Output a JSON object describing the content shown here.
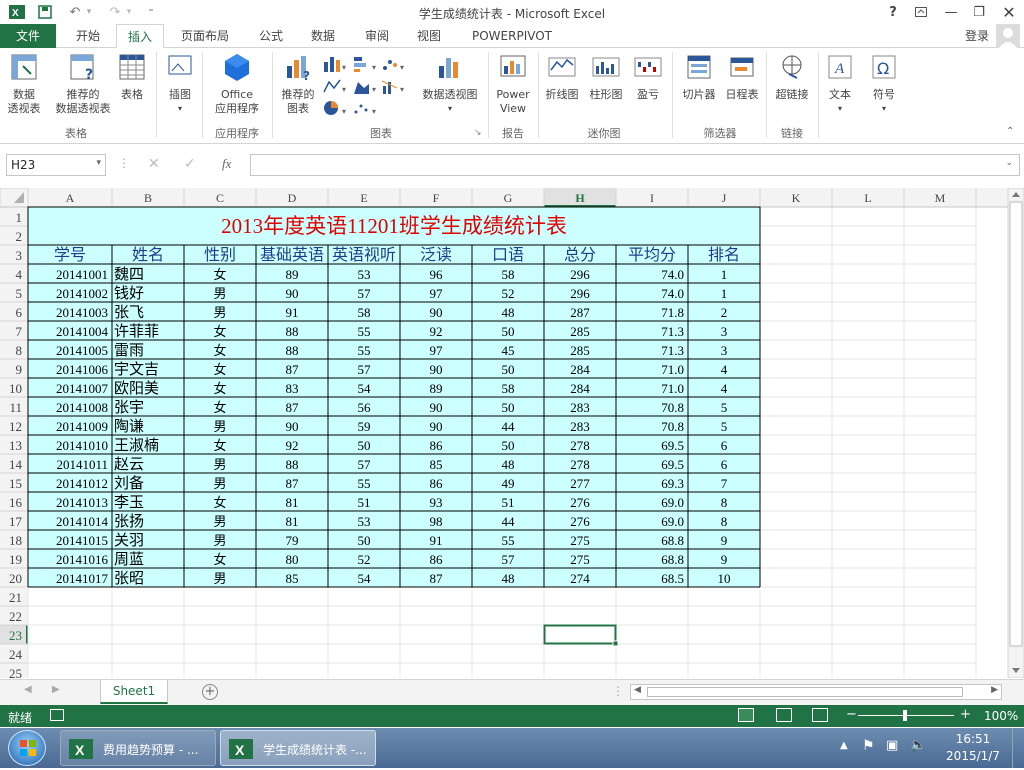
{
  "window": {
    "title": "学生成绩统计表 - Microsoft Excel",
    "help": "?",
    "login": "登录"
  },
  "tabs": [
    {
      "label": "文件",
      "id": "file"
    },
    {
      "label": "开始",
      "id": "home"
    },
    {
      "label": "插入",
      "id": "insert"
    },
    {
      "label": "页面布局",
      "id": "layout"
    },
    {
      "label": "公式",
      "id": "formulas"
    },
    {
      "label": "数据",
      "id": "data"
    },
    {
      "label": "审阅",
      "id": "review"
    },
    {
      "label": "视图",
      "id": "view"
    },
    {
      "label": "POWERPIVOT",
      "id": "powerpivot"
    }
  ],
  "ribbon": {
    "pivot_table": "数据\n透视表",
    "recommended_pivot": "推荐的\n数据透视表",
    "table": "表格",
    "illustrations": "插图",
    "office_apps": "Office\n应用程序",
    "recommended_charts": "推荐的\n图表",
    "pivot_chart": "数据透视图",
    "power_view": "Power\nView",
    "line_spark": "折线图",
    "column_spark": "柱形图",
    "winloss_spark": "盈亏",
    "slicer": "切片器",
    "timeline": "日程表",
    "hyperlink": "超链接",
    "text": "文本",
    "symbol": "符号",
    "groups": {
      "tables": "表格",
      "apps": "应用程序",
      "charts": "图表",
      "reports": "报告",
      "sparklines": "迷你图",
      "filters": "筛选器",
      "links": "链接"
    }
  },
  "namebox": "H23",
  "fx": "fx",
  "columns": [
    "A",
    "B",
    "C",
    "D",
    "E",
    "F",
    "G",
    "H",
    "I",
    "J",
    "K",
    "L",
    "M"
  ],
  "sheet_title": "2013年度英语11201班学生成绩统计表",
  "headers": [
    "学号",
    "姓名",
    "性别",
    "基础英语",
    "英语视听",
    "泛读",
    "口语",
    "总分",
    "平均分",
    "排名"
  ],
  "rows": [
    [
      "20141001",
      "魏四",
      "女",
      "89",
      "53",
      "96",
      "58",
      "296",
      "74.0",
      "1"
    ],
    [
      "20141002",
      "钱好",
      "男",
      "90",
      "57",
      "97",
      "52",
      "296",
      "74.0",
      "1"
    ],
    [
      "20141003",
      "张飞",
      "男",
      "91",
      "58",
      "90",
      "48",
      "287",
      "71.8",
      "2"
    ],
    [
      "20141004",
      "许菲菲",
      "女",
      "88",
      "55",
      "92",
      "50",
      "285",
      "71.3",
      "3"
    ],
    [
      "20141005",
      "雷雨",
      "女",
      "88",
      "55",
      "97",
      "45",
      "285",
      "71.3",
      "3"
    ],
    [
      "20141006",
      "宇文吉",
      "女",
      "87",
      "57",
      "90",
      "50",
      "284",
      "71.0",
      "4"
    ],
    [
      "20141007",
      "欧阳美",
      "女",
      "83",
      "54",
      "89",
      "58",
      "284",
      "71.0",
      "4"
    ],
    [
      "20141008",
      "张宇",
      "女",
      "87",
      "56",
      "90",
      "50",
      "283",
      "70.8",
      "5"
    ],
    [
      "20141009",
      "陶谦",
      "男",
      "90",
      "59",
      "90",
      "44",
      "283",
      "70.8",
      "5"
    ],
    [
      "20141010",
      "王淑楠",
      "女",
      "92",
      "50",
      "86",
      "50",
      "278",
      "69.5",
      "6"
    ],
    [
      "20141011",
      "赵云",
      "男",
      "88",
      "57",
      "85",
      "48",
      "278",
      "69.5",
      "6"
    ],
    [
      "20141012",
      "刘备",
      "男",
      "87",
      "55",
      "86",
      "49",
      "277",
      "69.3",
      "7"
    ],
    [
      "20141013",
      "李玉",
      "女",
      "81",
      "51",
      "93",
      "51",
      "276",
      "69.0",
      "8"
    ],
    [
      "20141014",
      "张扬",
      "男",
      "81",
      "53",
      "98",
      "44",
      "276",
      "69.0",
      "8"
    ],
    [
      "20141015",
      "关羽",
      "男",
      "79",
      "50",
      "91",
      "55",
      "275",
      "68.8",
      "9"
    ],
    [
      "20141016",
      "周蓝",
      "女",
      "80",
      "52",
      "86",
      "57",
      "275",
      "68.8",
      "9"
    ],
    [
      "20141017",
      "张昭",
      "男",
      "85",
      "54",
      "87",
      "48",
      "274",
      "68.5",
      "10"
    ]
  ],
  "sheet_tab": "Sheet1",
  "status": {
    "ready": "就绪",
    "zoom": "100%"
  },
  "taskbar": {
    "items": [
      "费用趋势预算 - ...",
      "学生成绩统计表 -..."
    ],
    "time": "16:51",
    "date": "2015/1/7"
  },
  "colors": {
    "excel_green": "#217346",
    "table_fill": "#ccffff",
    "title_red": "#e00000",
    "header_blue": "#1f3c88"
  }
}
